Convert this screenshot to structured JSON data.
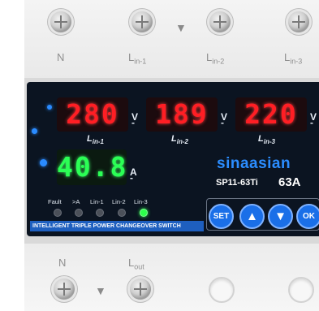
{
  "top_terminals": {
    "labels": [
      "N",
      "L",
      "L",
      "L"
    ],
    "subs": [
      "",
      "in-1",
      "in-2",
      "in-3"
    ],
    "arrow_icon": "chevron-down-icon"
  },
  "bottom_terminals": {
    "labels": [
      "N",
      "L"
    ],
    "subs": [
      "",
      "out"
    ],
    "arrow_icon": "chevron-down-icon"
  },
  "display": {
    "voltage_1": "280",
    "voltage_2": "189",
    "voltage_3": "220",
    "current": "40.8",
    "voltage_unit": "V",
    "current_unit": "A",
    "line_labels": [
      "L",
      "L",
      "L"
    ],
    "line_subs": [
      "in-1",
      "in-2",
      "in-3"
    ],
    "red_color": "#ff1e24",
    "green_color": "#2bff55"
  },
  "indicators": {
    "labels": [
      "Fault",
      ">A",
      "Lin-1",
      "Lin-2",
      "Lin-3"
    ],
    "active": [
      false,
      false,
      false,
      false,
      true
    ],
    "active_color": "#2cff4b"
  },
  "banner_text": "INTELLIGENT TRIPLE POWER CHANGEOVER SWITCH",
  "brand": {
    "name": "sinaasian",
    "model": "SP11-63Ti",
    "rating": "63A",
    "brand_color": "#2b8dff"
  },
  "buttons": {
    "set": "SET",
    "up_icon": "triangle-up-icon",
    "down_icon": "triangle-down-icon",
    "ok": "OK",
    "button_color": "#1a6fe8"
  }
}
